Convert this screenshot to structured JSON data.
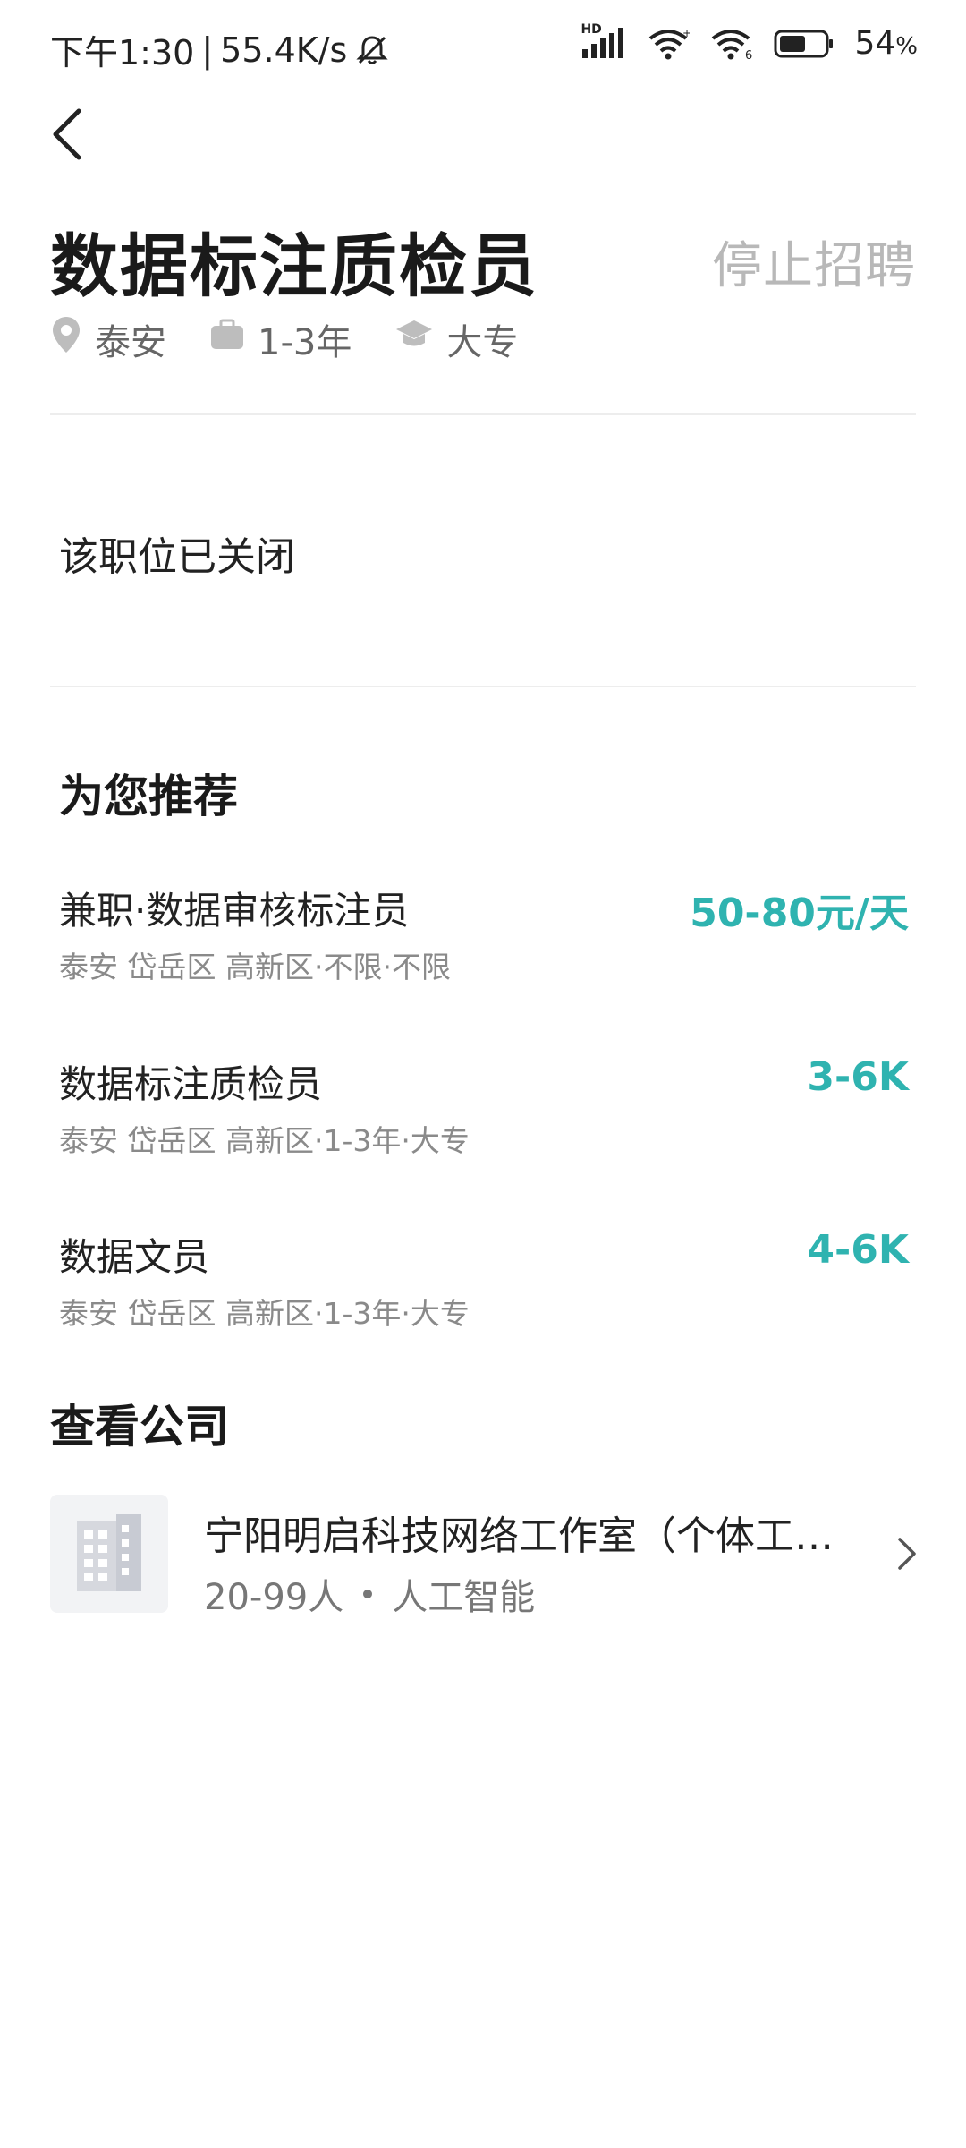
{
  "status_bar": {
    "time": "下午1:30",
    "separator": "|",
    "speed": "55.4K/s",
    "battery": "54",
    "battery_unit": "%",
    "network_label": "HD",
    "icons": [
      "mute-bell-icon",
      "signal-icon",
      "wifi-icon",
      "wifi-6-icon",
      "battery-icon"
    ]
  },
  "header": {
    "back_icon": "back-arrow-icon"
  },
  "job": {
    "title": "数据标注质检员",
    "status_action": "停止招聘",
    "location": "泰安",
    "experience": "1-3年",
    "education": "大专",
    "meta_icons": [
      "location-pin-icon",
      "briefcase-icon",
      "graduation-cap-icon"
    ]
  },
  "notice": "该职位已关闭",
  "recommend": {
    "section_title": "为您推荐",
    "items": [
      {
        "title": "兼职·数据审核标注员",
        "salary": "50-80元/天",
        "details": "泰安 岱岳区 高新区·不限·不限"
      },
      {
        "title": "数据标注质检员",
        "salary": "3-6K",
        "details": "泰安 岱岳区 高新区·1-3年·大专"
      },
      {
        "title": "数据文员",
        "salary": "4-6K",
        "details": "泰安 岱岳区 高新区·1-3年·大专"
      }
    ]
  },
  "company": {
    "section_title": "查看公司",
    "name": "宁阳明启科技网络工作室（个体工商...",
    "size": "20-99人",
    "industry": "人工智能",
    "logo_icon": "building-icon",
    "chevron_icon": "chevron-right-icon"
  },
  "colors": {
    "accent": "#2fb3b0",
    "muted": "#b8b8b8"
  }
}
